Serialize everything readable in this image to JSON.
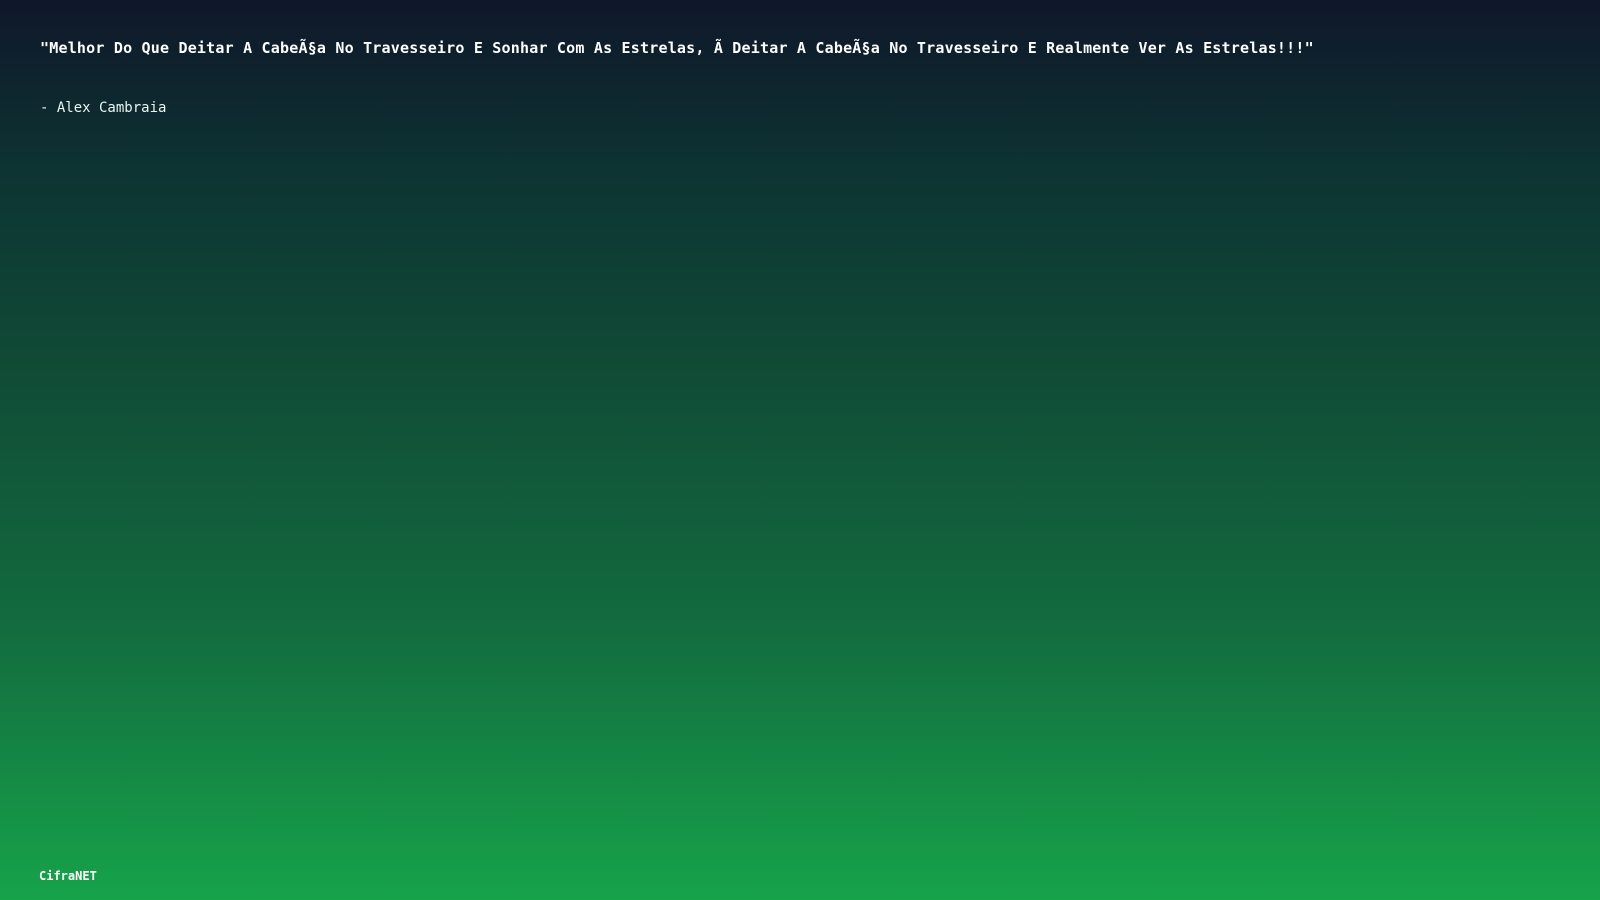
{
  "quote": {
    "text": "\"Melhor Do Que Deitar A CabeÃ§a No Travesseiro E Sonhar Com As Estrelas, Ã  Deitar A CabeÃ§a No Travesseiro E Realmente Ver As Estrelas!!!\"",
    "author": "- Alex Cambraia"
  },
  "brand": {
    "name": "CifraNET"
  },
  "colors": {
    "background_top": "#0f172a",
    "background_bottom": "#16a34a",
    "text": "#ffffff"
  }
}
